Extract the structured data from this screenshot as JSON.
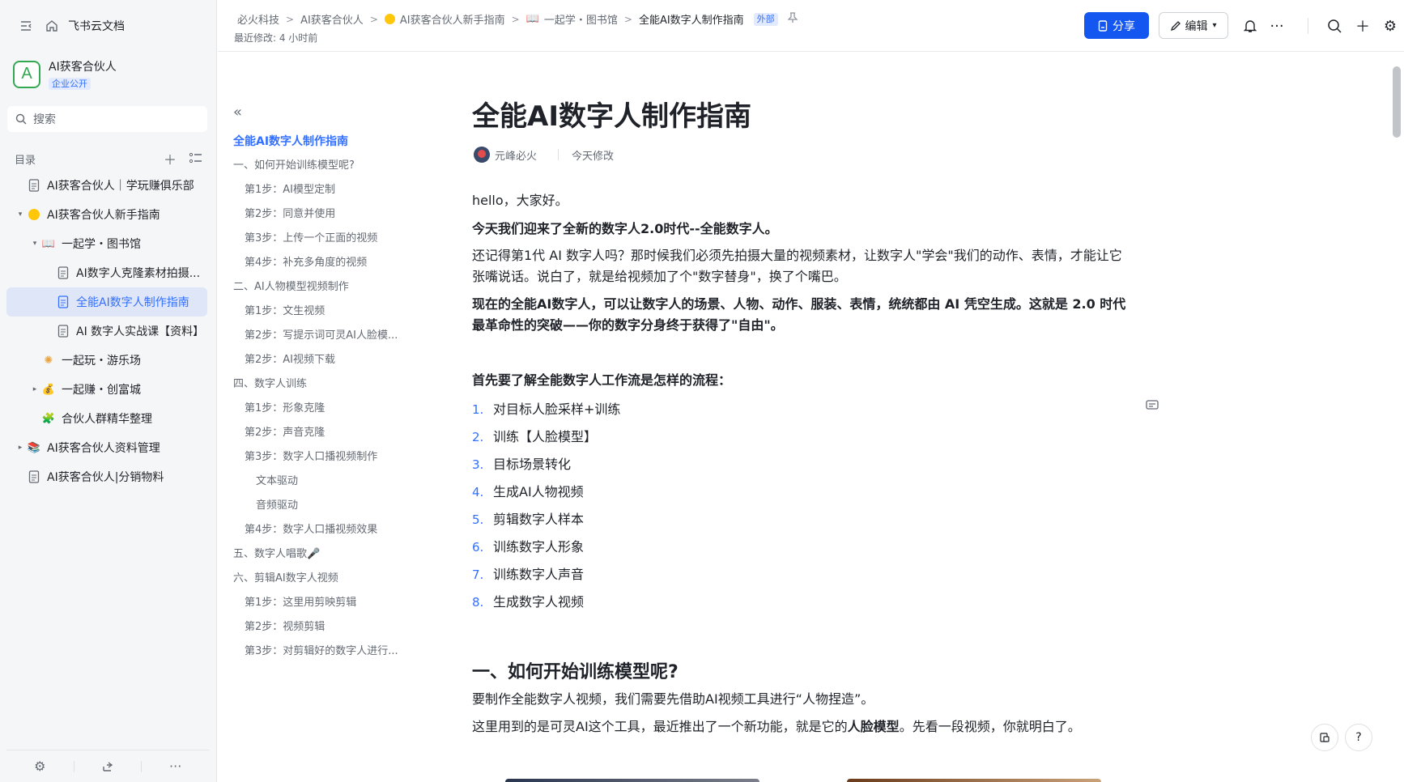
{
  "app": {
    "name": "飞书云文档"
  },
  "space": {
    "name": "AI获客合伙人",
    "badge": "企业公开",
    "avatar_letter": "A"
  },
  "search": {
    "placeholder": "搜索"
  },
  "toc": {
    "label": "目录",
    "items": [
      {
        "label": "AI获客合伙人｜学玩赚俱乐部",
        "level": 0,
        "arrow": "",
        "icon": "doc-icon"
      },
      {
        "label": "AI获客合伙人新手指南",
        "level": 0,
        "arrow": "▾",
        "icon": "yellow-circle-icon"
      },
      {
        "label": "一起学・图书馆",
        "level": 1,
        "arrow": "▾",
        "icon": "book-icon"
      },
      {
        "label": "AI数字人克隆素材拍摄...",
        "level": 2,
        "arrow": "",
        "icon": "doc-icon"
      },
      {
        "label": "全能AI数字人制作指南",
        "level": 2,
        "arrow": "",
        "icon": "doc-icon",
        "active": true
      },
      {
        "label": "AI 数字人实战课【资料】",
        "level": 2,
        "arrow": "",
        "icon": "doc-icon"
      },
      {
        "label": "一起玩・游乐场",
        "level": 1,
        "arrow": "",
        "icon": "sparkle-icon"
      },
      {
        "label": "一起赚・创富城",
        "level": 1,
        "arrow": "▸",
        "icon": "money-bag-icon"
      },
      {
        "label": "合伙人群精华整理",
        "level": 1,
        "arrow": "",
        "icon": "blocks-icon"
      },
      {
        "label": "AI获客合伙人资料管理",
        "level": 0,
        "arrow": "▸",
        "icon": "books-icon"
      },
      {
        "label": "AI获客合伙人|分销物料",
        "level": 0,
        "arrow": "",
        "icon": "doc-icon"
      }
    ]
  },
  "breadcrumb": {
    "items": [
      "必火科技",
      "AI获客合伙人",
      "AI获客合伙人新手指南",
      "一起学・图书馆",
      "全能AI数字人制作指南"
    ],
    "external_badge": "外部",
    "last_modified": "最近修改: 4 小时前"
  },
  "toolbar": {
    "share_label": "分享",
    "edit_label": "编辑"
  },
  "outline": [
    {
      "label": "全能AI数字人制作指南",
      "level": "title"
    },
    {
      "label": "一、如何开始训练模型呢?",
      "level": 1
    },
    {
      "label": "第1步：AI模型定制",
      "level": 2
    },
    {
      "label": "第2步：同意并使用",
      "level": 2
    },
    {
      "label": "第3步：上传一个正面的视频",
      "level": 2
    },
    {
      "label": "第4步：补充多角度的视频",
      "level": 2
    },
    {
      "label": "二、AI人物模型视频制作",
      "level": 1
    },
    {
      "label": "第1步：文生视频",
      "level": 2
    },
    {
      "label": "第2步：写提示词可灵AI人脸模...",
      "level": 2
    },
    {
      "label": "第2步：AI视频下载",
      "level": 2
    },
    {
      "label": "四、数字人训练",
      "level": 1
    },
    {
      "label": "第1步：形象克隆",
      "level": 2
    },
    {
      "label": "第2步：声音克隆",
      "level": 2
    },
    {
      "label": "第3步：数字人口播视频制作",
      "level": 2
    },
    {
      "label": "文本驱动",
      "level": 3
    },
    {
      "label": "音频驱动",
      "level": 3
    },
    {
      "label": "第4步：数字人口播视频效果",
      "level": 2
    },
    {
      "label": "五、数字人唱歌🎤",
      "level": 1
    },
    {
      "label": "六、剪辑AI数字人视频",
      "level": 1
    },
    {
      "label": "第1步：这里用剪映剪辑",
      "level": 2
    },
    {
      "label": "第2步：视频剪辑",
      "level": 2
    },
    {
      "label": "第3步：对剪辑好的数字人进行...",
      "level": 2
    }
  ],
  "doc": {
    "title": "全能AI数字人制作指南",
    "author": "元峰必火",
    "modified": "今天修改",
    "p1": "hello，大家好。",
    "p2": "今天我们迎来了全新的数字人2.0时代--全能数字人。",
    "p3a": "还记得第1代 AI 数字人吗？那时候我们必须先拍摄大量的视频素材，让数字人\"学会\"我们的动作、表情，才能让它",
    "p3b": "张嘴说话。说白了，就是给视频加了个\"数字替身\"，换了个嘴巴。",
    "p4a": "现在的全能AI数字人，可以让数字人的场景、人物、动作、服装、表情，统统都由 AI 凭空生成。这就是 2.0 时代",
    "p4b": "最革命性的突破——你的数字分身终于获得了\"自由\"。",
    "p5": "首先要了解全能数字人工作流是怎样的流程：",
    "steps": [
      {
        "num": "1.",
        "text": "对目标人脸采样+训练"
      },
      {
        "num": "2.",
        "text": "训练【人脸模型】"
      },
      {
        "num": "3.",
        "text": "目标场景转化"
      },
      {
        "num": "4.",
        "text": "生成AI人物视频"
      },
      {
        "num": "5.",
        "text": "剪辑数字人样本"
      },
      {
        "num": "6.",
        "text": "训练数字人形象"
      },
      {
        "num": "7.",
        "text": "训练数字人声音"
      },
      {
        "num": "8.",
        "text": "生成数字人视频"
      }
    ],
    "h1": "一、如何开始训练模型呢?",
    "p6": "要制作全能数字人视频，我们需要先借助AI视频工具进行“人物捏造”。",
    "p7a": "这里用到的是可灵AI这个工具，最近推出了一个新功能，就是它的",
    "p7b": "人脸模型",
    "p7c": "。先看一段视频，你就明白了。"
  },
  "colors": {
    "accent": "#3370ff",
    "share_bg": "#1456f0",
    "sidebar_bg": "#f5f6f7",
    "active_bg": "#dfe6f8"
  }
}
